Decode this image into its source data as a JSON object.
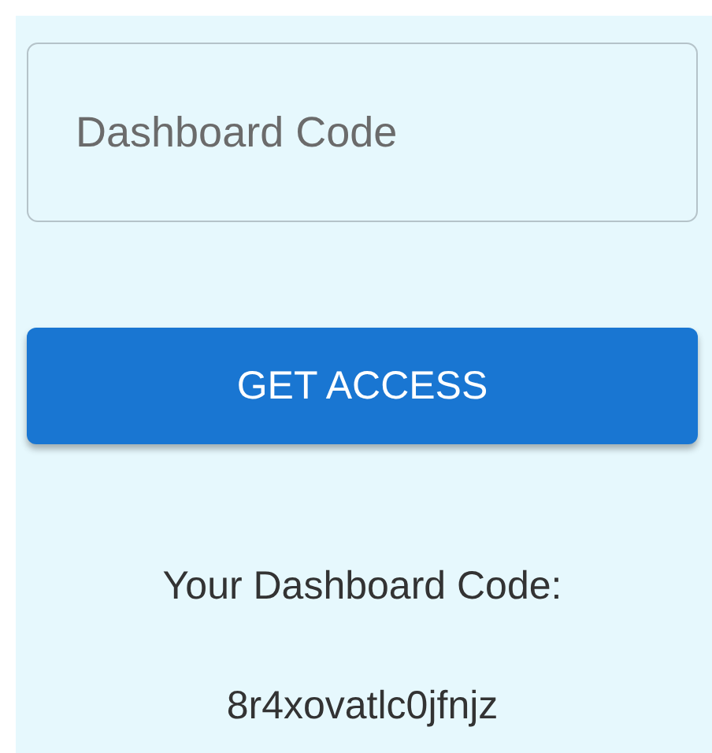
{
  "code_field": {
    "placeholder": "Dashboard Code"
  },
  "access_button": {
    "label": "GET ACCESS"
  },
  "code_label": "Your Dashboard Code:",
  "code_value": "8r4xovatlc0jfnjz"
}
